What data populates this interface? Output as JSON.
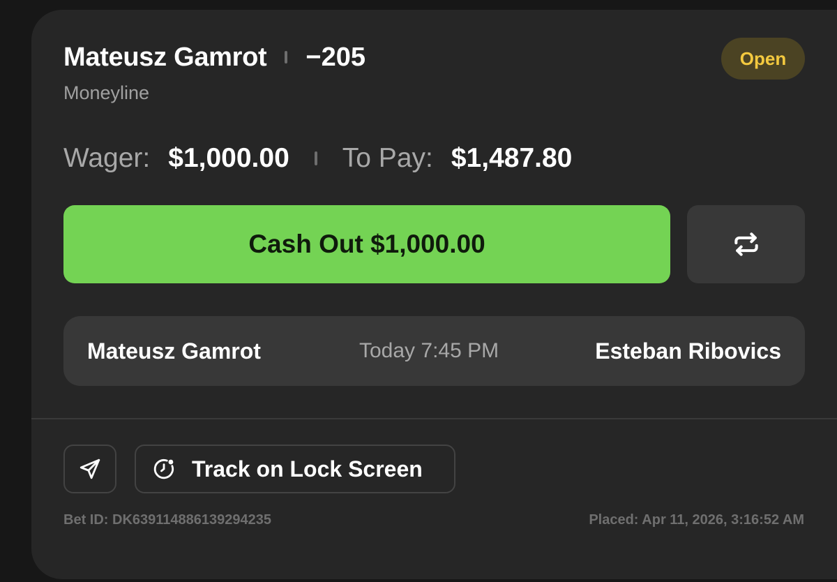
{
  "bet": {
    "selection": "Mateusz Gamrot",
    "odds": "−205",
    "market": "Moneyline",
    "status": "Open"
  },
  "amounts": {
    "wager_label": "Wager:",
    "wager_value": "$1,000.00",
    "to_pay_label": "To Pay:",
    "to_pay_value": "$1,487.80"
  },
  "actions": {
    "cash_out_label": "Cash Out $1,000.00",
    "refresh_icon": "refresh-icon",
    "share_icon": "send-icon",
    "track_icon": "clock-icon",
    "track_label": "Track on Lock Screen"
  },
  "matchup": {
    "fighter_left": "Mateusz Gamrot",
    "time": "Today 7:45 PM",
    "fighter_right": "Esteban Ribovics"
  },
  "footer": {
    "bet_id": "Bet ID: DK639114886139294235",
    "placed": "Placed: Apr 11, 2026, 3:16:52 AM"
  },
  "colors": {
    "accent_green": "#74d354",
    "status_yellow": "#f3c93f",
    "card_bg": "#262626"
  }
}
